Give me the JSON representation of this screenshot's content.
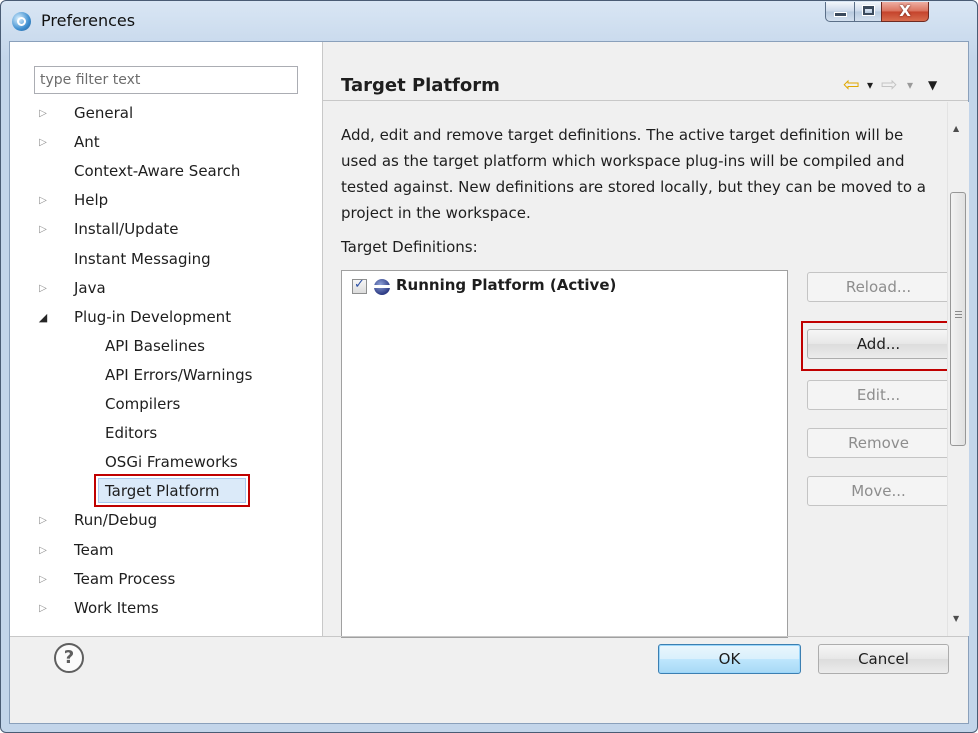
{
  "window": {
    "title": "Preferences",
    "icon": "preferences-app-icon",
    "controls": {
      "minimize_icon": "minimize-icon",
      "maximize_icon": "maximize-icon",
      "close_glyph": "X"
    }
  },
  "filter": {
    "placeholder": "type filter text",
    "value": ""
  },
  "tree": {
    "items": [
      {
        "label": "General",
        "twisty": "▷"
      },
      {
        "label": "Ant",
        "twisty": "▷"
      },
      {
        "label": "Context-Aware Search",
        "twisty": ""
      },
      {
        "label": "Help",
        "twisty": "▷"
      },
      {
        "label": "Install/Update",
        "twisty": "▷"
      },
      {
        "label": "Instant Messaging",
        "twisty": ""
      },
      {
        "label": "Java",
        "twisty": "▷"
      },
      {
        "label": "Plug-in Development",
        "twisty": "◢"
      },
      {
        "label": "API Baselines",
        "twisty": ""
      },
      {
        "label": "API Errors/Warnings",
        "twisty": ""
      },
      {
        "label": "Compilers",
        "twisty": ""
      },
      {
        "label": "Editors",
        "twisty": ""
      },
      {
        "label": "OSGi Frameworks",
        "twisty": ""
      },
      {
        "label": "Target Platform",
        "twisty": ""
      },
      {
        "label": "Run/Debug",
        "twisty": "▷"
      },
      {
        "label": "Team",
        "twisty": "▷"
      },
      {
        "label": "Team Process",
        "twisty": "▷"
      },
      {
        "label": "Work Items",
        "twisty": "▷"
      }
    ],
    "selected": "Target Platform"
  },
  "page": {
    "title": "Target Platform",
    "nav": {
      "back": "⇦",
      "back_menu": "▾",
      "forward": "⇨",
      "forward_menu": "▾",
      "view_menu": "▼"
    },
    "description": "Add, edit and remove target definitions.  The active target definition will be used as the target platform which workspace plug-ins will be compiled and tested against.  New definitions are stored locally, but they can be moved to a project in the workspace.",
    "defs_label": "Target Definitions:",
    "definitions": [
      {
        "label": "Running Platform (Active)",
        "checked": true,
        "checkmark": "✓",
        "icon": "target-platform-icon"
      }
    ],
    "buttons": {
      "reload": "Reload...",
      "add": "Add...",
      "edit": "Edit...",
      "remove": "Remove",
      "move": "Move..."
    },
    "scroll": {
      "up": "▲",
      "down": "▼"
    }
  },
  "footer": {
    "help_glyph": "?",
    "ok": "OK",
    "cancel": "Cancel"
  },
  "colors": {
    "highlight": "#c00000",
    "selection": "#dbeaf9"
  }
}
